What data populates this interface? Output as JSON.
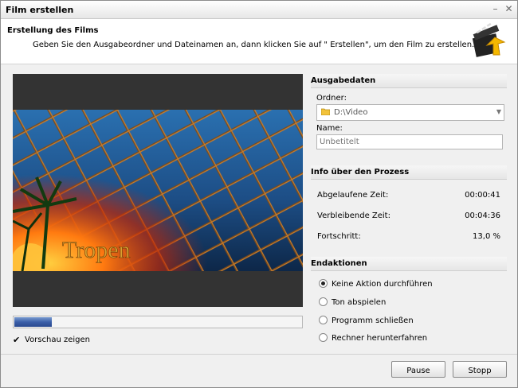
{
  "window": {
    "title": "Film erstellen"
  },
  "header": {
    "title": "Erstellung des Films",
    "description": "Geben Sie den Ausgabeordner und Dateinamen an, dann klicken Sie auf \" Erstellen\", um den Film zu erstellen."
  },
  "preview": {
    "overlay_text": "Tropen",
    "progress_fraction": 0.13,
    "show_preview_label": "Vorschau zeigen",
    "show_preview_checked": true
  },
  "output": {
    "section_title": "Ausgabedaten",
    "folder_label": "Ordner:",
    "folder_value": "D:\\Video",
    "name_label": "Name:",
    "name_placeholder": "Unbetitelt"
  },
  "process": {
    "section_title": "Info über den Prozess",
    "elapsed_label": "Abgelaufene Zeit:",
    "elapsed_value": "00:00:41",
    "remaining_label": "Verbleibende Zeit:",
    "remaining_value": "00:04:36",
    "progress_label": "Fortschritt:",
    "progress_value": "13,0 %"
  },
  "end_actions": {
    "section_title": "Endaktionen",
    "options": [
      {
        "label": "Keine Aktion durchführen",
        "selected": true
      },
      {
        "label": "Ton abspielen",
        "selected": false
      },
      {
        "label": "Programm schließen",
        "selected": false
      },
      {
        "label": "Rechner herunterfahren",
        "selected": false
      }
    ]
  },
  "buttons": {
    "pause": "Pause",
    "stop": "Stopp"
  },
  "colors": {
    "progress_fill": "#3a5ea8",
    "preview_bg": "#333333"
  }
}
